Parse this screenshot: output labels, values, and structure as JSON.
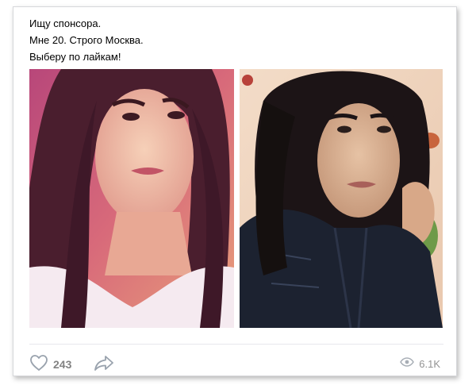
{
  "post": {
    "lines": [
      "Ищу спонсора.",
      "Мне 20. Строго Москва.",
      "Выберу по лайкам!"
    ]
  },
  "photos": [
    {
      "name": "photo-1"
    },
    {
      "name": "photo-2"
    }
  ],
  "actions": {
    "likes": "243",
    "views": "6.1K",
    "like_icon": "heart-icon",
    "share_icon": "share-arrow-icon",
    "views_icon": "eye-icon"
  },
  "colors": {
    "icon": "#99a2ad",
    "counter": "#828282",
    "divider": "#e7e8ec"
  }
}
